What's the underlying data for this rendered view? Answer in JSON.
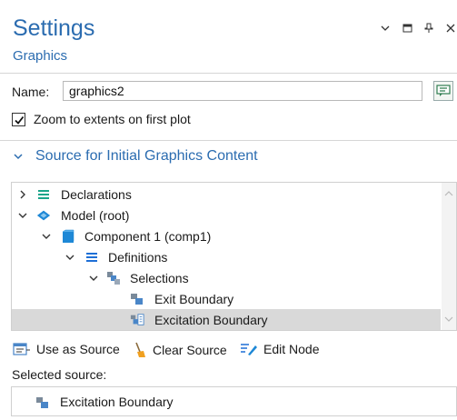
{
  "header": {
    "title": "Settings",
    "subtitle": "Graphics"
  },
  "window_buttons": [
    {
      "name": "chevron-down-icon",
      "glyph": "⌄"
    },
    {
      "name": "maximize-icon",
      "glyph": "▭"
    },
    {
      "name": "pin-icon",
      "glyph": "⊥"
    },
    {
      "name": "close-icon",
      "glyph": "✕"
    }
  ],
  "name_field": {
    "label": "Name:",
    "value": "graphics2"
  },
  "zoom_checkbox": {
    "label": "Zoom to extents on first plot",
    "checked": true
  },
  "section": {
    "title": "Source for Initial Graphics Content",
    "expanded": true
  },
  "tree": {
    "items": [
      {
        "label": "Declarations",
        "icon": "list-icon",
        "twisty": ">",
        "selected": false
      },
      {
        "label": "Model (root)",
        "icon": "model-icon",
        "twisty": "⌄",
        "selected": false
      },
      {
        "label": "Component 1 (comp1)",
        "icon": "component-icon",
        "twisty": "⌄",
        "selected": false
      },
      {
        "label": "Definitions",
        "icon": "definitions-icon",
        "twisty": "⌄",
        "selected": false
      },
      {
        "label": "Selections",
        "icon": "selections-icon",
        "twisty": "⌄",
        "selected": false
      },
      {
        "label": "Exit Boundary",
        "icon": "selection-icon",
        "twisty": "",
        "selected": false
      },
      {
        "label": "Excitation Boundary",
        "icon": "explicit-selection-icon",
        "twisty": "",
        "selected": true
      }
    ]
  },
  "toolbar": {
    "use_as_source": "Use as Source",
    "clear_source": "Clear Source",
    "edit_node": "Edit Node"
  },
  "selected_source": {
    "label": "Selected source:",
    "value": "Excitation Boundary"
  },
  "colors": {
    "accent": "#2b6cb0",
    "selection_bg": "#d9d9d9",
    "icon_blue": "#1e88d6",
    "icon_teal": "#1aa58a"
  }
}
